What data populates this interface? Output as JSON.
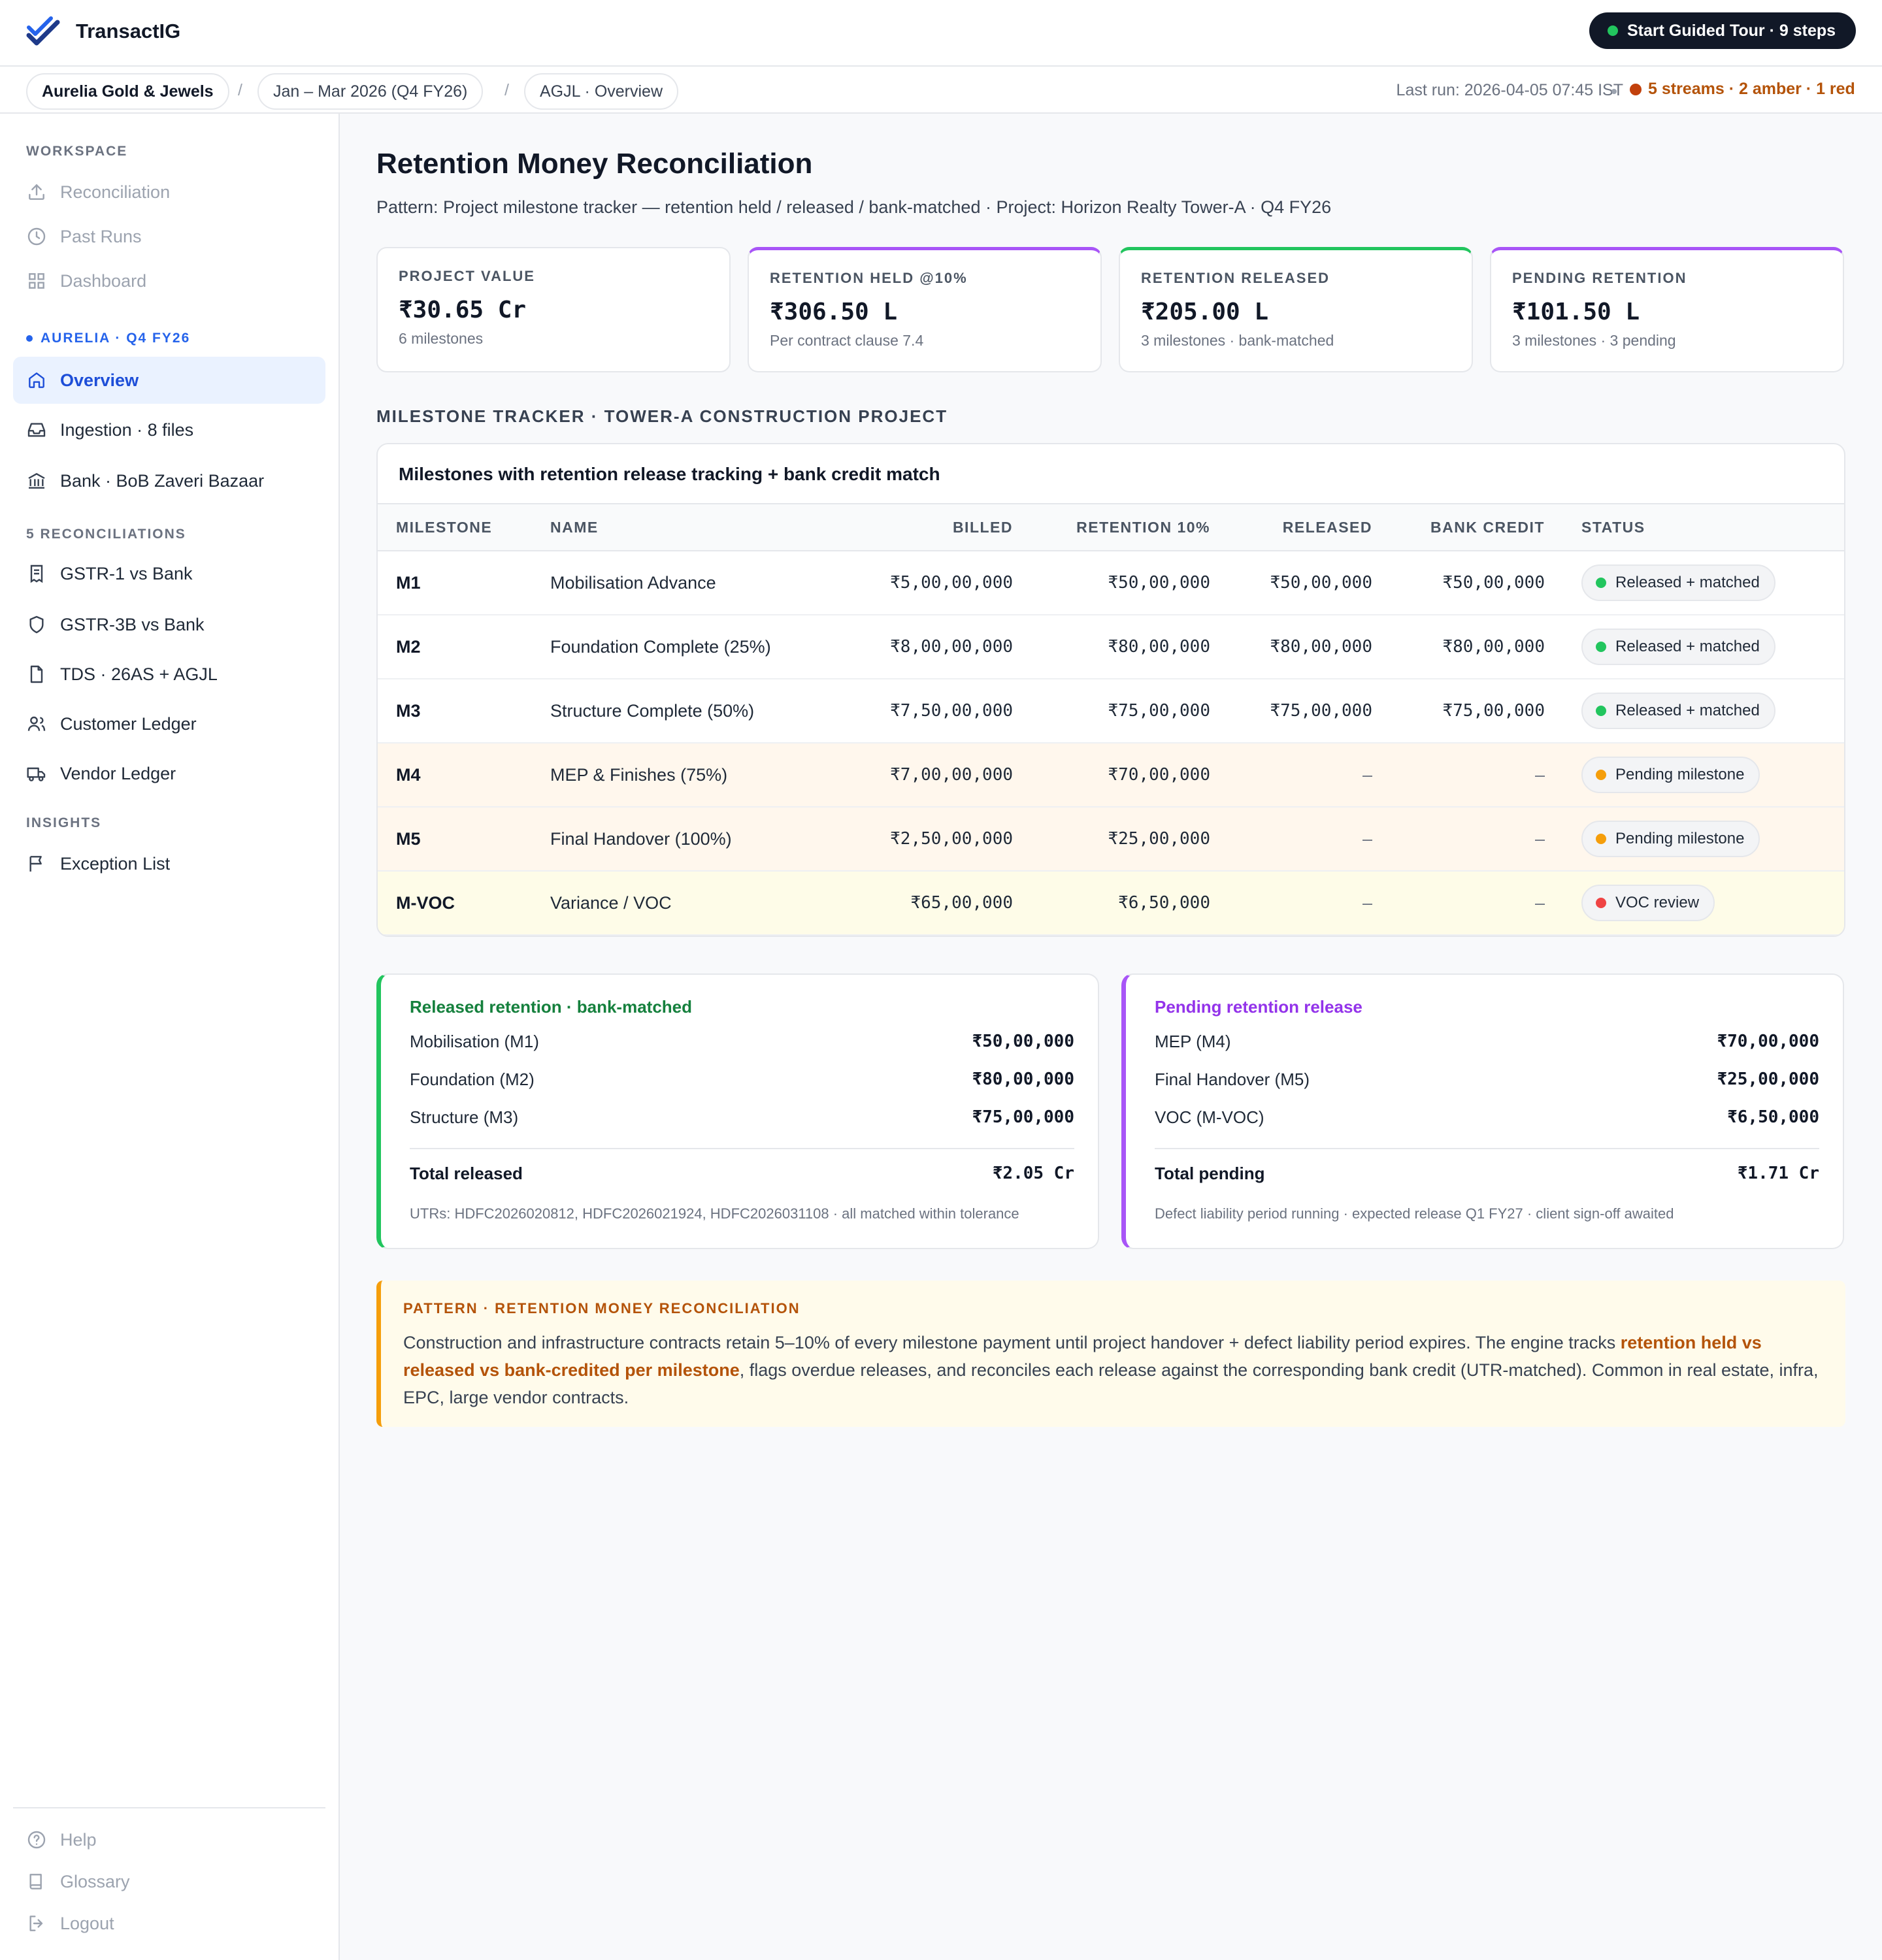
{
  "app": {
    "name": "TransactIG"
  },
  "tour": {
    "label": "Start Guided Tour · 9 steps"
  },
  "breadcrumbs": [
    {
      "label": "Aurelia Gold & Jewels"
    },
    {
      "label": "Jan – Mar 2026 (Q4 FY26)"
    },
    {
      "label": "AGJL · Overview"
    }
  ],
  "status": {
    "last_run": "Last run: 2026-04-05 07:45 IST",
    "streams": "5 streams · 2 amber · 1 red"
  },
  "sidebar": {
    "workspace_heading": "WORKSPACE",
    "workspace": [
      {
        "label": "Reconciliation",
        "icon": "upload-icon"
      },
      {
        "label": "Past Runs",
        "icon": "clock-icon"
      },
      {
        "label": "Dashboard",
        "icon": "grid-icon"
      }
    ],
    "client_heading": "AURELIA · Q4 FY26",
    "client": [
      {
        "label": "Overview",
        "icon": "home-icon",
        "active": true
      },
      {
        "label": "Ingestion · 8 files",
        "icon": "inbox-icon"
      },
      {
        "label": "Bank · BoB Zaveri Bazaar",
        "icon": "bank-icon"
      }
    ],
    "recon_heading": "5 RECONCILIATIONS",
    "reconciliations": [
      {
        "label": "GSTR-1 vs Bank",
        "icon": "receipt-icon"
      },
      {
        "label": "GSTR-3B vs Bank",
        "icon": "shield-icon"
      },
      {
        "label": "TDS · 26AS + AGJL",
        "icon": "file-icon"
      },
      {
        "label": "Customer Ledger",
        "icon": "users-icon"
      },
      {
        "label": "Vendor Ledger",
        "icon": "truck-icon"
      }
    ],
    "insights_heading": "INSIGHTS",
    "insights": [
      {
        "label": "Exception List",
        "icon": "flag-icon"
      }
    ],
    "footer": [
      {
        "label": "Help",
        "icon": "help-icon"
      },
      {
        "label": "Glossary",
        "icon": "book-icon"
      },
      {
        "label": "Logout",
        "icon": "logout-icon"
      }
    ]
  },
  "page": {
    "title": "Retention Money Reconciliation",
    "subtitle": "Pattern: Project milestone tracker — retention held / released / bank-matched · Project: Horizon Realty Tower-A · Q4 FY26"
  },
  "kpis": [
    {
      "label": "PROJECT VALUE",
      "value": "₹30.65 Cr",
      "note": "6 milestones"
    },
    {
      "label": "RETENTION HELD @10%",
      "value": "₹306.50 L",
      "note": "Per contract clause 7.4"
    },
    {
      "label": "RETENTION RELEASED",
      "value": "₹205.00 L",
      "note": "3 milestones · bank-matched"
    },
    {
      "label": "PENDING RETENTION",
      "value": "₹101.50 L",
      "note": "3 milestones · 3 pending"
    }
  ],
  "tracker": {
    "section_label": "MILESTONE TRACKER · TOWER-A CONSTRUCTION PROJECT",
    "title": "Milestones with retention release tracking + bank credit match",
    "columns": [
      "MILESTONE",
      "NAME",
      "BILLED",
      "RETENTION 10%",
      "RELEASED",
      "BANK CREDIT",
      "STATUS"
    ],
    "rows": [
      {
        "milestone": "M1",
        "name": "Mobilisation Advance",
        "billed": "₹5,00,00,000",
        "retention": "₹50,00,000",
        "released": "₹50,00,000",
        "bank_credit": "₹50,00,000",
        "status": "Released + matched",
        "status_color": "#22c55e"
      },
      {
        "milestone": "M2",
        "name": "Foundation Complete (25%)",
        "billed": "₹8,00,00,000",
        "retention": "₹80,00,000",
        "released": "₹80,00,000",
        "bank_credit": "₹80,00,000",
        "status": "Released + matched",
        "status_color": "#22c55e"
      },
      {
        "milestone": "M3",
        "name": "Structure Complete (50%)",
        "billed": "₹7,50,00,000",
        "retention": "₹75,00,000",
        "released": "₹75,00,000",
        "bank_credit": "₹75,00,000",
        "status": "Released + matched",
        "status_color": "#22c55e"
      },
      {
        "milestone": "M4",
        "name": "MEP & Finishes (75%)",
        "billed": "₹7,00,00,000",
        "retention": "₹70,00,000",
        "released": "–",
        "bank_credit": "–",
        "status": "Pending milestone",
        "status_color": "#f59e0b"
      },
      {
        "milestone": "M5",
        "name": "Final Handover (100%)",
        "billed": "₹2,50,00,000",
        "retention": "₹25,00,000",
        "released": "–",
        "bank_credit": "–",
        "status": "Pending milestone",
        "status_color": "#f59e0b"
      },
      {
        "milestone": "M-VOC",
        "name": "Variance / VOC",
        "billed": "₹65,00,000",
        "retention": "₹6,50,000",
        "released": "–",
        "bank_credit": "–",
        "status": "VOC review",
        "status_color": "#ef4444"
      }
    ]
  },
  "released_panel": {
    "title": "Released retention · bank-matched",
    "items": [
      {
        "label": "Mobilisation (M1)",
        "value": "₹50,00,000"
      },
      {
        "label": "Foundation (M2)",
        "value": "₹80,00,000"
      },
      {
        "label": "Structure (M3)",
        "value": "₹75,00,000"
      }
    ],
    "total_label": "Total released",
    "total_value": "₹2.05 Cr",
    "note": "UTRs: HDFC2026020812, HDFC2026021924, HDFC2026031108 · all matched within tolerance"
  },
  "pending_panel": {
    "title": "Pending retention release",
    "items": [
      {
        "label": "MEP (M4)",
        "value": "₹70,00,000"
      },
      {
        "label": "Final Handover (M5)",
        "value": "₹25,00,000"
      },
      {
        "label": "VOC (M-VOC)",
        "value": "₹6,50,000"
      }
    ],
    "total_label": "Total pending",
    "total_value": "₹1.71 Cr",
    "note": "Defect liability period running · expected release Q1 FY27 · client sign-off awaited"
  },
  "pattern": {
    "label": "PATTERN · RETENTION MONEY RECONCILIATION",
    "text_before": "Construction and infrastructure contracts retain 5–10% of every milestone payment until project handover + defect liability period expires. The engine tracks ",
    "highlight": "retention held vs released vs bank-credited per milestone",
    "text_after": ", flags overdue releases, and reconciles each release against the corresponding bank credit (UTR-matched). Common in real estate, infra, EPC, large vendor contracts."
  },
  "colors": {
    "accent": "#2563eb",
    "green": "#22c55e",
    "amber": "#f59e0b",
    "red": "#ef4444",
    "purple": "#a855f7"
  }
}
